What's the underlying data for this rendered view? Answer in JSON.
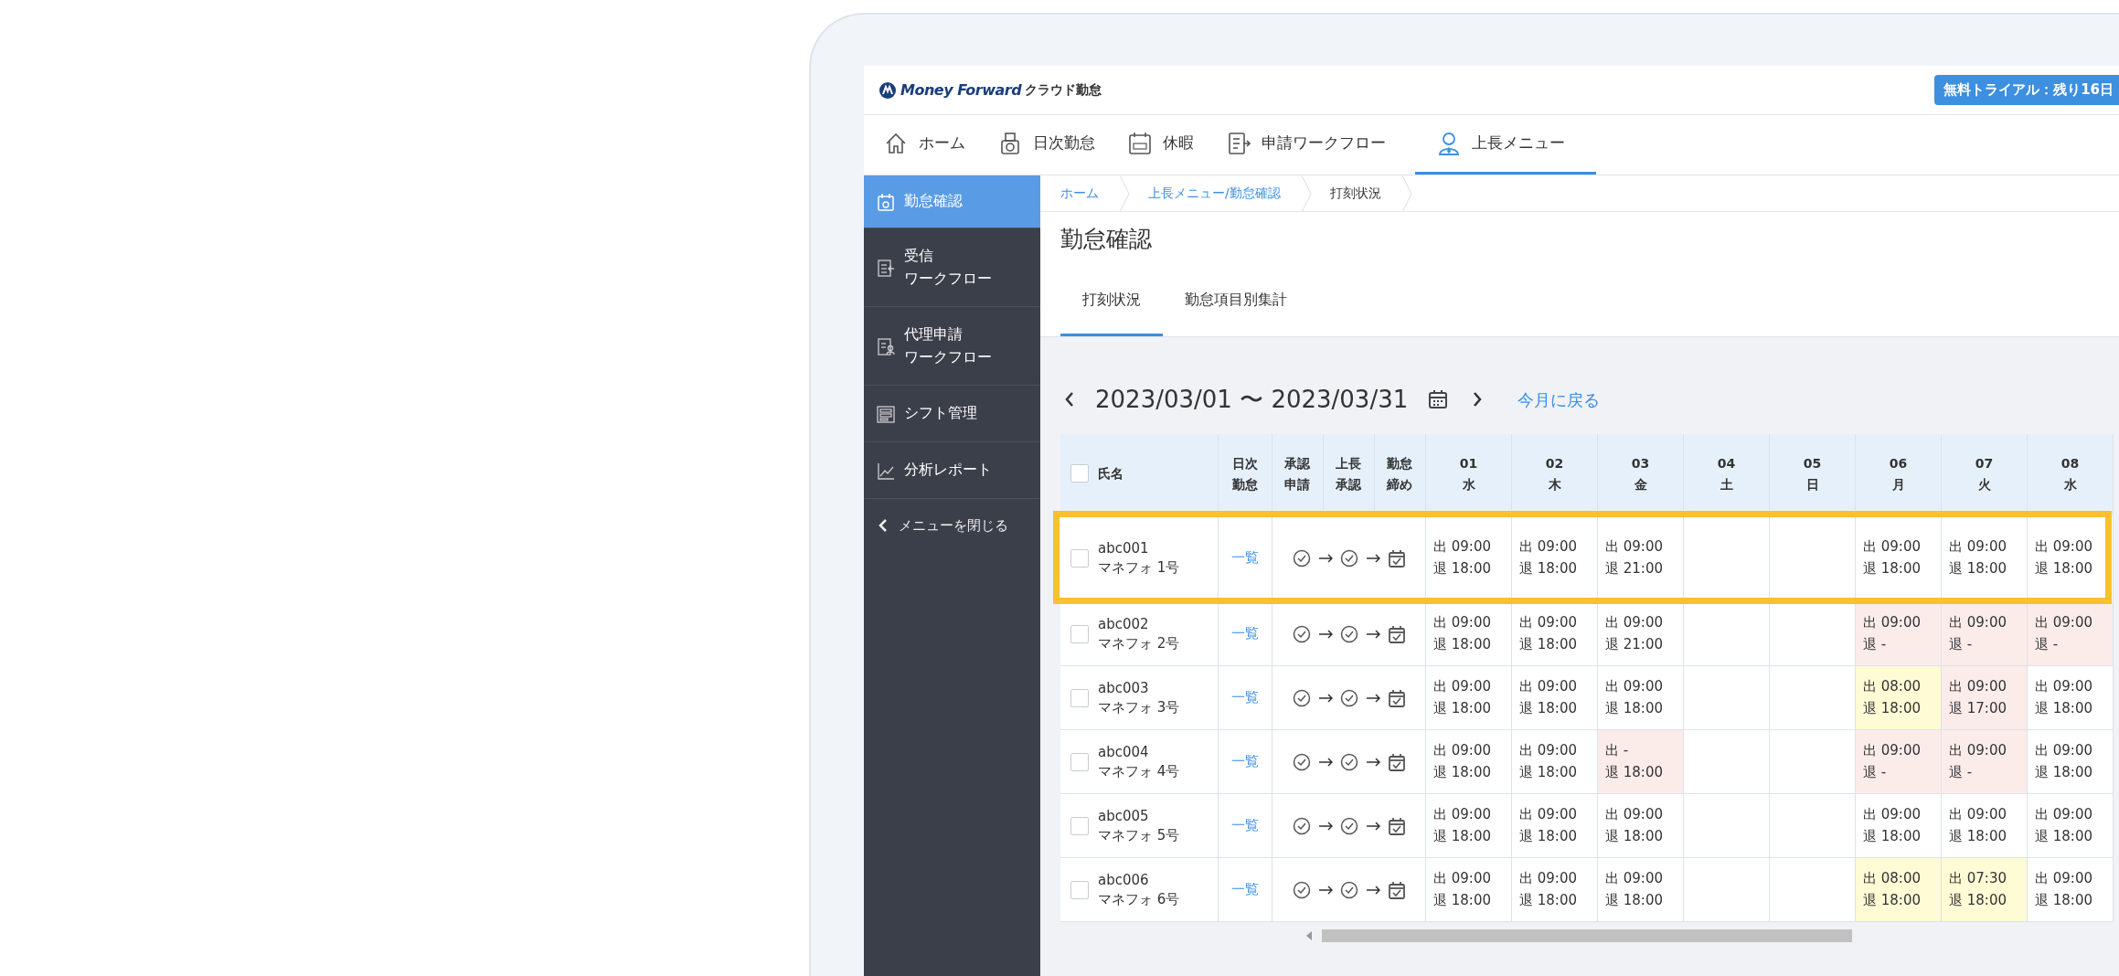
{
  "header": {
    "logo": "Money Forward",
    "product": "クラウド勤怠",
    "trial_badge": "無料トライアル：残り16日"
  },
  "nav": [
    {
      "label": "ホーム",
      "kind": "home",
      "selected": false
    },
    {
      "label": "日次勤怠",
      "kind": "timecard",
      "selected": false
    },
    {
      "label": "休暇",
      "kind": "leave",
      "selected": false
    },
    {
      "label": "申請ワークフロー",
      "kind": "form",
      "selected": false
    },
    {
      "label": "上長メニュー",
      "kind": "person",
      "selected": true
    }
  ],
  "sidebar": {
    "items": [
      {
        "lines": [
          "勤怠確認"
        ],
        "kind": "calendar",
        "selected": true
      },
      {
        "lines": [
          "受信",
          "ワークフロー"
        ],
        "kind": "inbox",
        "selected": false
      },
      {
        "lines": [
          "代理申請",
          "ワークフロー"
        ],
        "kind": "proxy",
        "selected": false
      },
      {
        "lines": [
          "シフト管理"
        ],
        "kind": "shift",
        "selected": false
      },
      {
        "lines": [
          "分析レポート"
        ],
        "kind": "chart",
        "selected": false
      }
    ],
    "collapse": "メニューを閉じる"
  },
  "breadcrumb": [
    {
      "label": "ホーム",
      "kind": "link"
    },
    {
      "label": "上長メニュー/勤怠確認",
      "kind": "link"
    },
    {
      "label": "打刻状況",
      "kind": "current"
    }
  ],
  "page_title": "勤怠確認",
  "tabs": [
    {
      "label": "打刻状況",
      "selected": true
    },
    {
      "label": "勤怠項目別集計",
      "selected": false
    }
  ],
  "period": {
    "range": "2023/03/01 〜 2023/03/31",
    "today_link": "今月に戻る"
  },
  "table": {
    "select_all_checked": false,
    "columns": [
      "氏名",
      "日次勤怠",
      "承認申請",
      "上長承認",
      "勤怠締め"
    ],
    "days": [
      {
        "date": "01",
        "weekday": "水"
      },
      {
        "date": "02",
        "weekday": "木"
      },
      {
        "date": "03",
        "weekday": "金"
      },
      {
        "date": "04",
        "weekday": "土"
      },
      {
        "date": "05",
        "weekday": "日"
      },
      {
        "date": "06",
        "weekday": "月"
      },
      {
        "date": "07",
        "weekday": "火"
      },
      {
        "date": "08",
        "weekday": "水"
      }
    ],
    "rows": [
      {
        "id": "abc001",
        "name": "マネフォ 1号",
        "link": "一覧",
        "checked": false,
        "highlighted": true,
        "cells": [
          {
            "in": "出 09:00",
            "out": "退 18:00",
            "kind": "normal"
          },
          {
            "in": "出 09:00",
            "out": "退 18:00",
            "kind": "normal"
          },
          {
            "in": "出 09:00",
            "out": "退 21:00",
            "kind": "normal"
          },
          null,
          null,
          {
            "in": "出 09:00",
            "out": "退 18:00",
            "kind": "normal"
          },
          {
            "in": "出 09:00",
            "out": "退 18:00",
            "kind": "normal"
          },
          {
            "in": "出 09:00",
            "out": "退 18:00",
            "kind": "normal"
          }
        ]
      },
      {
        "id": "abc002",
        "name": "マネフォ 2号",
        "link": "一覧",
        "checked": false,
        "highlighted": false,
        "cells": [
          {
            "in": "出 09:00",
            "out": "退 18:00",
            "kind": "normal"
          },
          {
            "in": "出 09:00",
            "out": "退 18:00",
            "kind": "normal"
          },
          {
            "in": "出 09:00",
            "out": "退 21:00",
            "kind": "normal"
          },
          null,
          null,
          {
            "in": "出 09:00",
            "out": "退 -",
            "kind": "error"
          },
          {
            "in": "出 09:00",
            "out": "退 -",
            "kind": "error"
          },
          {
            "in": "出 09:00",
            "out": "退 -",
            "kind": "error"
          }
        ]
      },
      {
        "id": "abc003",
        "name": "マネフォ 3号",
        "link": "一覧",
        "checked": false,
        "highlighted": false,
        "cells": [
          {
            "in": "出 09:00",
            "out": "退 18:00",
            "kind": "normal"
          },
          {
            "in": "出 09:00",
            "out": "退 18:00",
            "kind": "normal"
          },
          {
            "in": "出 09:00",
            "out": "退 18:00",
            "kind": "normal"
          },
          null,
          null,
          {
            "in": "出 08:00",
            "out": "退 18:00",
            "kind": "warning"
          },
          {
            "in": "出 09:00",
            "out": "退 17:00",
            "kind": "error"
          },
          {
            "in": "出 09:00",
            "out": "退 18:00",
            "kind": "normal"
          }
        ]
      },
      {
        "id": "abc004",
        "name": "マネフォ 4号",
        "link": "一覧",
        "checked": false,
        "highlighted": false,
        "cells": [
          {
            "in": "出 09:00",
            "out": "退 18:00",
            "kind": "normal"
          },
          {
            "in": "出 09:00",
            "out": "退 18:00",
            "kind": "normal"
          },
          {
            "in": "出 -",
            "out": "退 18:00",
            "kind": "error"
          },
          null,
          null,
          {
            "in": "出 09:00",
            "out": "退 -",
            "kind": "error"
          },
          {
            "in": "出 09:00",
            "out": "退 -",
            "kind": "error"
          },
          {
            "in": "出 09:00",
            "out": "退 18:00",
            "kind": "normal"
          }
        ]
      },
      {
        "id": "abc005",
        "name": "マネフォ 5号",
        "link": "一覧",
        "checked": false,
        "highlighted": false,
        "cells": [
          {
            "in": "出 09:00",
            "out": "退 18:00",
            "kind": "normal"
          },
          {
            "in": "出 09:00",
            "out": "退 18:00",
            "kind": "normal"
          },
          {
            "in": "出 09:00",
            "out": "退 18:00",
            "kind": "normal"
          },
          null,
          null,
          {
            "in": "出 09:00",
            "out": "退 18:00",
            "kind": "normal"
          },
          {
            "in": "出 09:00",
            "out": "退 18:00",
            "kind": "normal"
          },
          {
            "in": "出 09:00",
            "out": "退 18:00",
            "kind": "normal"
          }
        ]
      },
      {
        "id": "abc006",
        "name": "マネフォ 6号",
        "link": "一覧",
        "checked": false,
        "highlighted": false,
        "cells": [
          {
            "in": "出 09:00",
            "out": "退 18:00",
            "kind": "normal"
          },
          {
            "in": "出 09:00",
            "out": "退 18:00",
            "kind": "normal"
          },
          {
            "in": "出 09:00",
            "out": "退 18:00",
            "kind": "normal"
          },
          null,
          null,
          {
            "in": "出 08:00",
            "out": "退 18:00",
            "kind": "warning"
          },
          {
            "in": "出 07:30",
            "out": "退 18:00",
            "kind": "warning"
          },
          {
            "in": "出 09:00",
            "out": "退 18:00",
            "kind": "normal"
          }
        ]
      }
    ]
  }
}
